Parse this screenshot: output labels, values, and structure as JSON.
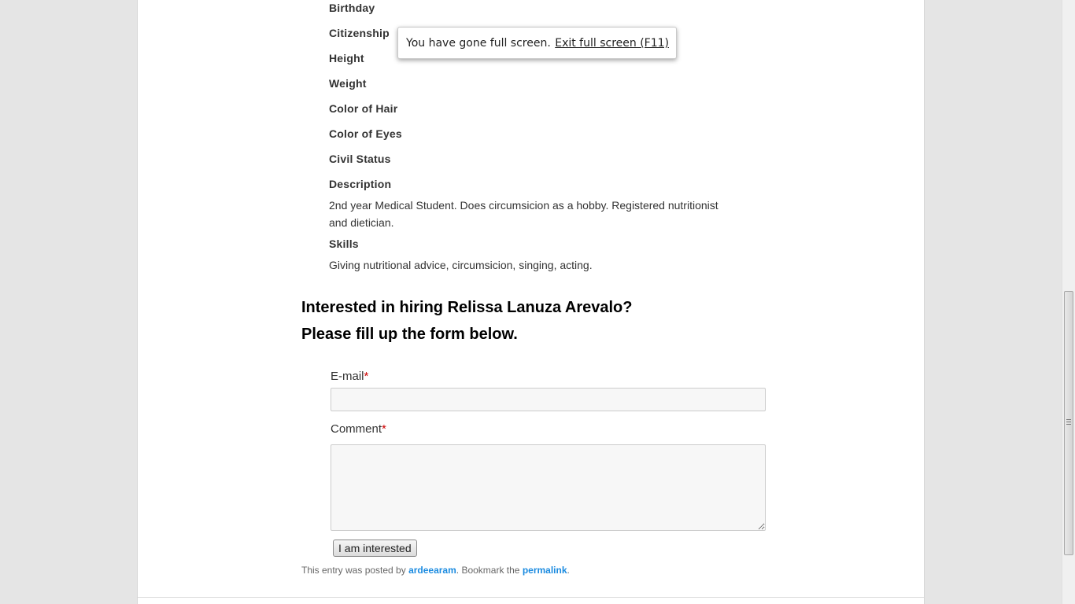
{
  "profile": {
    "fields": [
      {
        "label": "Birthday"
      },
      {
        "label": "Citizenship"
      },
      {
        "label": "Height"
      },
      {
        "label": "Weight"
      },
      {
        "label": "Color of Hair"
      },
      {
        "label": "Color of Eyes"
      },
      {
        "label": "Civil Status"
      }
    ],
    "description_label": "Description",
    "description_text": "2nd year Medical Student. Does circumsicion as a hobby. Registered nutritionist and dietician.",
    "skills_label": "Skills",
    "skills_text": "Giving nutritional advice, circumsicion, singing, acting."
  },
  "hire": {
    "heading_line1": "Interested in hiring Relissa Lanuza Arevalo?",
    "heading_line2": "Please fill up the form below."
  },
  "form": {
    "email_label": "E-mail",
    "email_value": "",
    "comment_label": "Comment",
    "comment_value": "",
    "required_mark": "*",
    "submit_label": "I am interested"
  },
  "footer": {
    "prefix": "This entry was posted by ",
    "author": "ardeearam",
    "middle": ". Bookmark the ",
    "permalink": "permalink",
    "suffix": "."
  },
  "fullscreen_notice": {
    "message": "You have gone full screen.",
    "exit_label": "Exit full screen (F11)"
  },
  "colors": {
    "link": "#1b8be0",
    "required": "#cc0000"
  }
}
